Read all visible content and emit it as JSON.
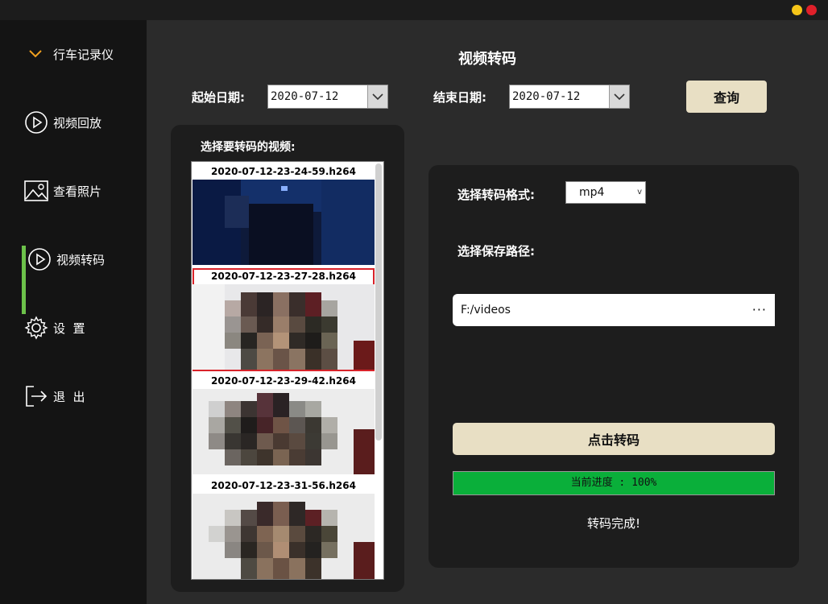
{
  "window": {
    "colors": {
      "minimize": "#f5c518",
      "close": "#e0202a"
    }
  },
  "sidebar": {
    "header_label": "行车记录仪",
    "items": [
      {
        "label": "视频回放",
        "icon": "play-circle-icon"
      },
      {
        "label": "查看照片",
        "icon": "image-icon"
      },
      {
        "label": "视频转码",
        "icon": "play-circle-icon",
        "active": true
      },
      {
        "label": "设  置",
        "icon": "gear-icon"
      },
      {
        "label": "退  出",
        "icon": "exit-icon"
      }
    ],
    "accent_color": "#6cc24a"
  },
  "main": {
    "title": "视频转码",
    "start_label": "起始日期:",
    "start_date": "2020-07-12",
    "end_label": "结束日期:",
    "end_date": "2020-07-12",
    "query_label": "查询"
  },
  "video_list": {
    "title": "选择要转码的视频:",
    "items": [
      {
        "name": "2020-07-12-23-24-59.h264",
        "selected": false
      },
      {
        "name": "2020-07-12-23-27-28.h264",
        "selected": true
      },
      {
        "name": "2020-07-12-23-29-42.h264",
        "selected": false
      },
      {
        "name": "2020-07-12-23-31-56.h264",
        "selected": false
      }
    ]
  },
  "convert": {
    "format_label": "选择转码格式:",
    "format_value": "mp4",
    "path_label": "选择保存路径:",
    "path_value": "F:/videos",
    "browse_label": "···",
    "button_label": "点击转码",
    "progress_text": "当前进度 : 100%",
    "progress_value": 1.0,
    "progress_color": "#0aaf3a",
    "status_text": "转码完成!"
  }
}
